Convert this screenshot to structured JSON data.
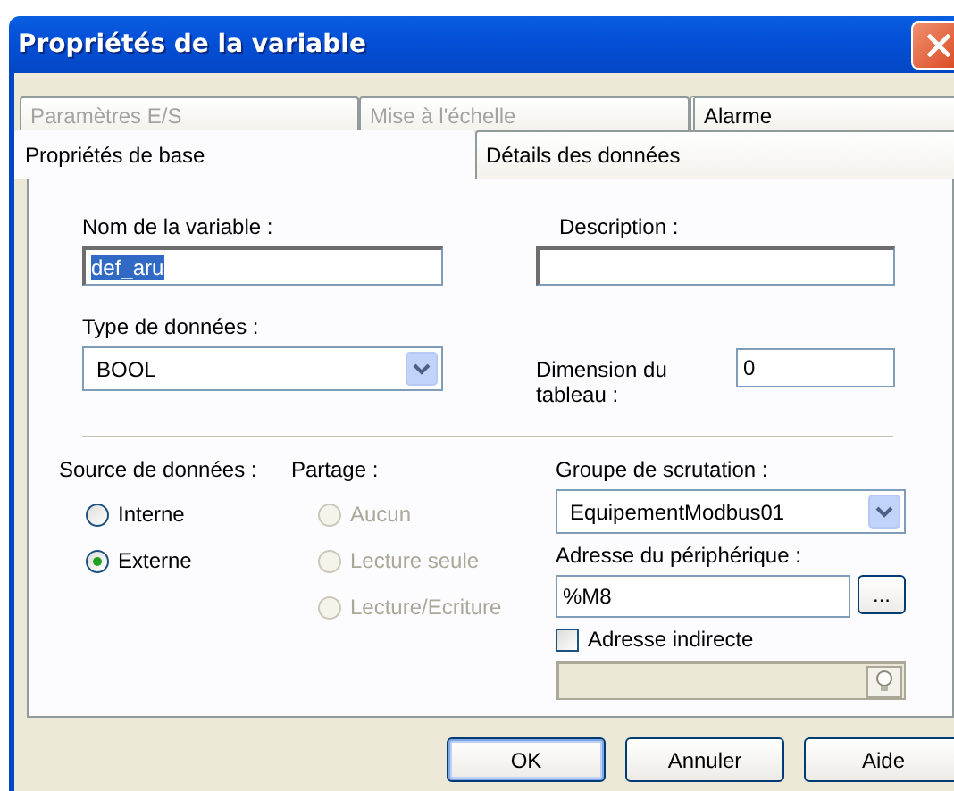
{
  "window": {
    "title": "Propriétés de la variable"
  },
  "tab_rows": [
    [
      {
        "label": "Paramètres E/S",
        "selected": false,
        "disabled": true
      },
      {
        "label": "Mise à l'échelle",
        "selected": false,
        "disabled": true
      },
      {
        "label": "Alarme",
        "selected": false,
        "disabled": false
      }
    ],
    [
      {
        "label": "Propriétés de base",
        "selected": true,
        "disabled": false
      },
      {
        "label": "Détails des données",
        "selected": false,
        "disabled": false
      }
    ]
  ],
  "variable_name": {
    "label": "Nom de la variable :",
    "value": "def_aru",
    "highlighted": true
  },
  "description": {
    "label": "Description :"
  },
  "data_type": {
    "label": "Type de données :",
    "value": "BOOL"
  },
  "array_dimension": {
    "label": "Dimension du tableau :",
    "value": "0"
  },
  "data_source": {
    "label": "Source de données :",
    "options": [
      {
        "label": "Interne",
        "selected": false,
        "disabled": false
      },
      {
        "label": "Externe",
        "selected": true,
        "disabled": false
      }
    ]
  },
  "sharing": {
    "label": "Partage :",
    "options": [
      {
        "label": "Aucun",
        "selected": false,
        "disabled": true
      },
      {
        "label": "Lecture seule",
        "selected": false,
        "disabled": true
      },
      {
        "label": "Lecture/Ecriture",
        "selected": false,
        "disabled": true
      }
    ]
  },
  "scan_group": {
    "label": "Groupe de scrutation :",
    "value": "EquipementModbus01"
  },
  "device_address": {
    "label": "Adresse du périphérique :",
    "value": "%M8",
    "browse": "..."
  },
  "indirect_address": {
    "label": "Adresse indirecte",
    "checked": false,
    "field_disabled": true
  },
  "buttons": [
    {
      "label": "OK",
      "default": true
    },
    {
      "label": "Annuler",
      "default": false
    },
    {
      "label": "Aide",
      "default": false
    }
  ]
}
